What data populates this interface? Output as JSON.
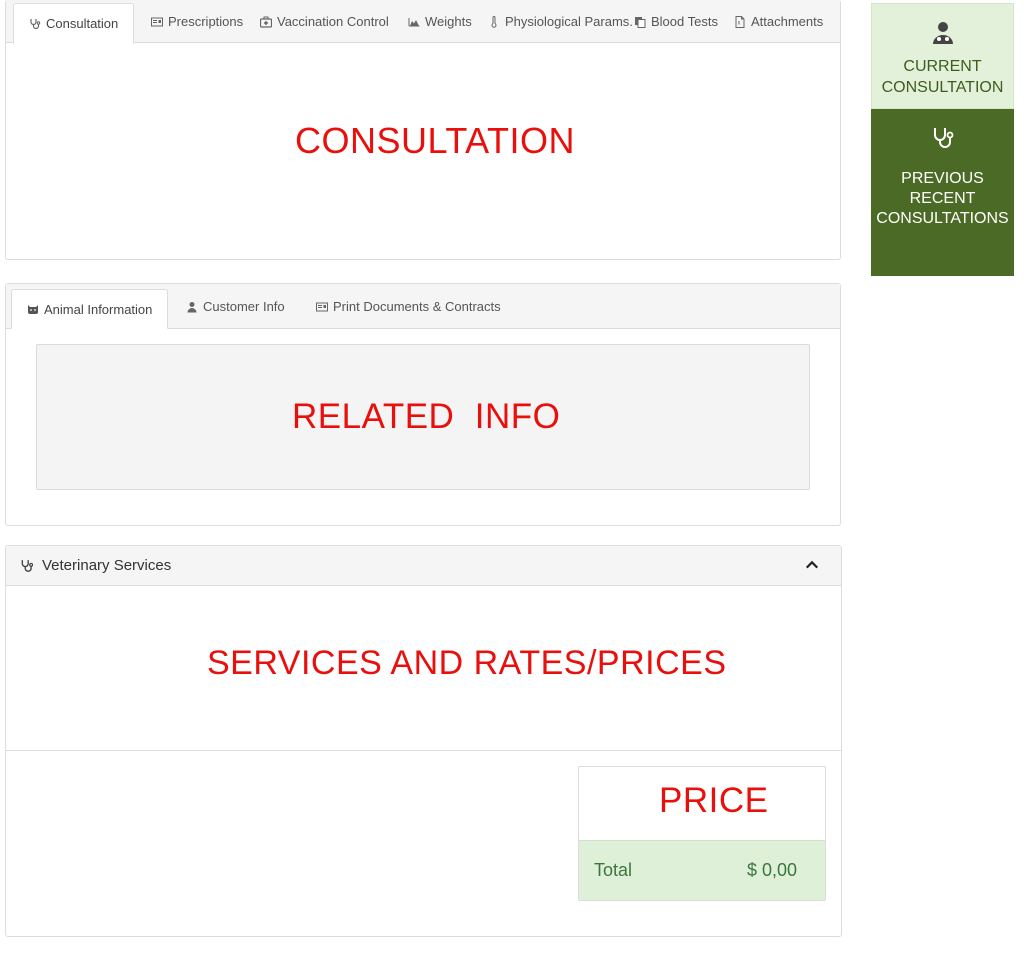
{
  "consultation_tabs": [
    {
      "label": "Consultation",
      "icon": "stethoscope-icon"
    },
    {
      "label": "Prescriptions",
      "icon": "id-card-icon"
    },
    {
      "label": "Vaccination Control",
      "icon": "medkit-icon"
    },
    {
      "label": "Weights",
      "icon": "area-chart-icon"
    },
    {
      "label": "Physiological Params.",
      "icon": "thermometer-icon"
    },
    {
      "label": "Blood Tests",
      "icon": "copy-icon"
    },
    {
      "label": "Attachments",
      "icon": "file-icon"
    }
  ],
  "consultation_placeholder": "CONSULTATION",
  "related_tabs": [
    {
      "label": "Animal Information",
      "icon": "cat-icon"
    },
    {
      "label": "Customer Info",
      "icon": "user-icon"
    },
    {
      "label": "Print Documents & Contracts",
      "icon": "id-card-icon"
    }
  ],
  "related_placeholder": "RELATED  INFO",
  "services": {
    "title": "Veterinary Services",
    "placeholder": "SERVICES AND RATES/PRICES",
    "price_placeholder": "PRICE",
    "total_label": "Total",
    "total_value": "$ 0,00"
  },
  "sidebar": {
    "current_label": "CURRENT CONSULTATION",
    "previous_label": "PREVIOUS RECENT CONSULTATIONS"
  },
  "colors": {
    "placeholder_red": "#e8100c",
    "sidebar_current_bg": "#e4f1da",
    "sidebar_previous_bg": "#4a6a25",
    "total_bg": "#dff0d8",
    "total_text": "#3c763d"
  }
}
